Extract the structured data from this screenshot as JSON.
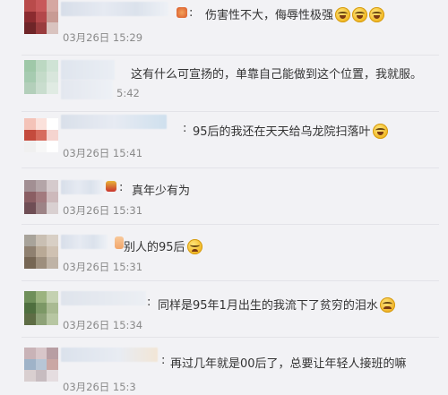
{
  "comments": [
    {
      "text": "伤害性不大，侮辱性极强",
      "time": "03月26日 15:29",
      "emojis": [
        "laugh-cry-emoji",
        "laugh-cry-emoji",
        "laugh-cry-emoji"
      ]
    },
    {
      "text": "这有什么可宣扬的，单靠自己能做到这个位置，我就服。",
      "time": "5:42"
    },
    {
      "text": "95后的我还在天天给乌龙院扫落叶",
      "time": "03月26日 15:41",
      "emojis": [
        "laugh-cry-emoji"
      ]
    },
    {
      "text": "真年少有为",
      "time": "03月26日 15:31"
    },
    {
      "text": "别人的95后",
      "time": "03月26日 15:31",
      "emojis": [
        "sad-emoji"
      ]
    },
    {
      "text": "同样是95年1月出生的我流下了贫穷的泪水",
      "time": "03月26日 15:34",
      "emojis": [
        "crying-emoji"
      ]
    },
    {
      "text": "再过几年就是00后了，总要让年轻人接班的嘛",
      "time": "03月26日 15:3"
    }
  ],
  "colors": {
    "background": "#f2f2f5",
    "text": "#333333",
    "time": "#8a8a8a"
  }
}
